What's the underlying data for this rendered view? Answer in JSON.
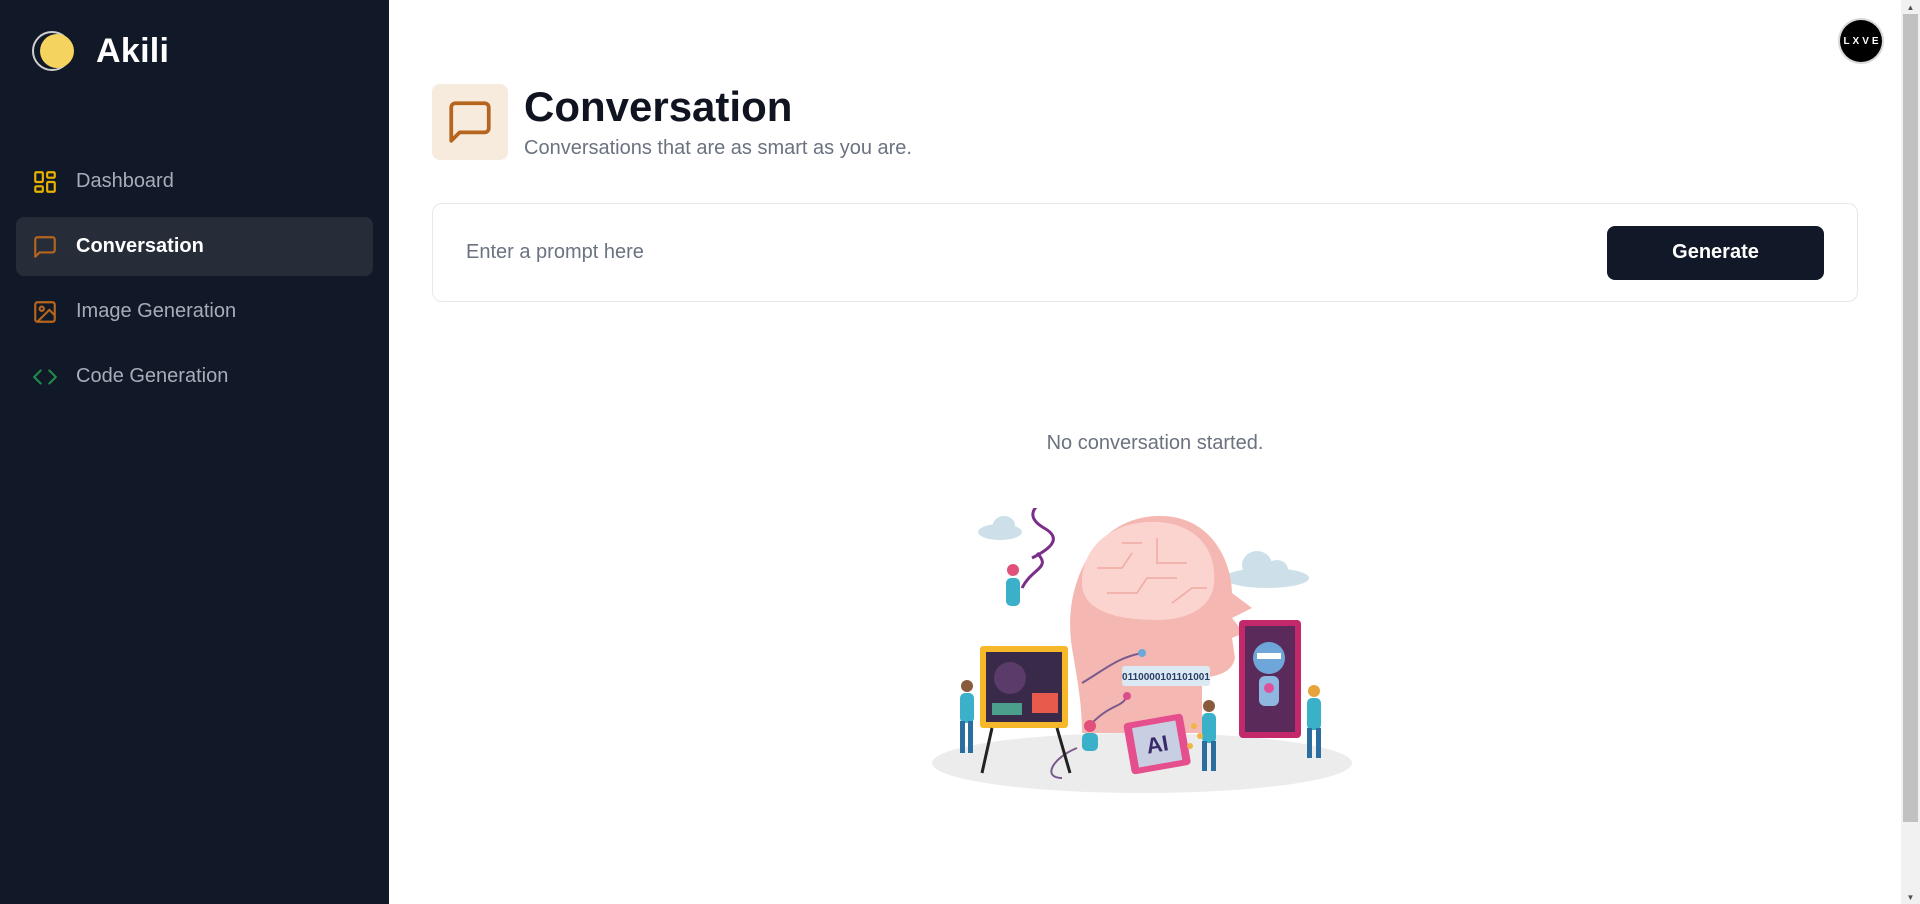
{
  "brand": {
    "name": "Akili"
  },
  "sidebar": {
    "items": [
      {
        "label": "Dashboard",
        "icon": "dashboard-icon",
        "color": "#e9b200",
        "active": false
      },
      {
        "label": "Conversation",
        "icon": "message-icon",
        "color": "#b5651d",
        "active": true
      },
      {
        "label": "Image Generation",
        "icon": "image-icon",
        "color": "#b5651d",
        "active": false
      },
      {
        "label": "Code Generation",
        "icon": "code-icon",
        "color": "#1f8a4c",
        "active": false
      }
    ]
  },
  "header": {
    "avatar_text": "LXVE",
    "title": "Conversation",
    "subtitle": "Conversations that are as smart as you are."
  },
  "prompt": {
    "placeholder": "Enter a prompt here",
    "value": "",
    "button_label": "Generate"
  },
  "empty_state": {
    "message": "No conversation started.",
    "illustration_labels": {
      "binary": "0110000101101001",
      "chip": "AI"
    }
  },
  "colors": {
    "sidebar_bg": "#111827",
    "active_item_bg": "#262c38",
    "accent_amber": "#b5651d",
    "accent_yellow": "#e9b200",
    "accent_green": "#1f8a4c",
    "button_bg": "#111827"
  }
}
